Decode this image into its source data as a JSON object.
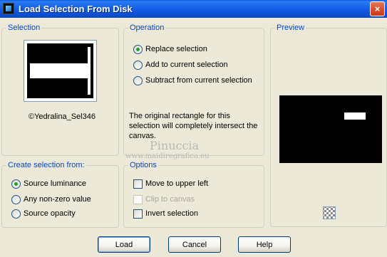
{
  "window": {
    "title": "Load Selection From Disk",
    "close_glyph": "×"
  },
  "selection": {
    "group_label": "Selection",
    "caption": "©Yedralina_Sel346"
  },
  "operation": {
    "group_label": "Operation",
    "options": [
      {
        "label": "Replace selection",
        "checked": true
      },
      {
        "label": "Add to current selection",
        "checked": false
      },
      {
        "label": "Subtract from current selection",
        "checked": false
      }
    ],
    "description": "The original rectangle for this selection will completely intersect the canvas."
  },
  "preview": {
    "group_label": "Preview"
  },
  "create_from": {
    "group_label": "Create selection from:",
    "options": [
      {
        "label": "Source luminance",
        "checked": true
      },
      {
        "label": "Any non-zero value",
        "checked": false
      },
      {
        "label": "Source opacity",
        "checked": false
      }
    ]
  },
  "options": {
    "group_label": "Options",
    "items": [
      {
        "label": "Move to upper left",
        "checked": false,
        "disabled": false
      },
      {
        "label": "Clip to canvas",
        "checked": false,
        "disabled": true
      },
      {
        "label": "Invert selection",
        "checked": false,
        "disabled": false
      }
    ]
  },
  "watermark": {
    "title": "Pinuccia",
    "url": "www.maidiregrafica.eu"
  },
  "buttons": {
    "load": "Load",
    "cancel": "Cancel",
    "help": "Help"
  },
  "colors": {
    "titlebar": "#0a5ae0",
    "group_label": "#0046d5",
    "dialog_bg": "#ece9d8",
    "radio_checked": "#21a121"
  }
}
